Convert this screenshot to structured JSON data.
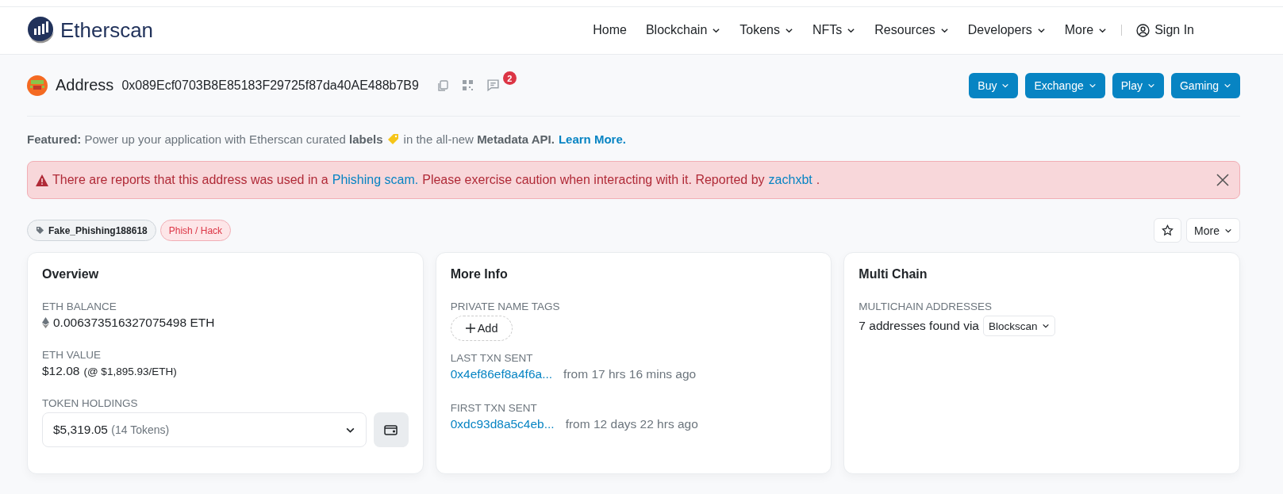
{
  "header": {
    "logo": "Etherscan",
    "nav": [
      {
        "label": "Home",
        "kind": "link"
      },
      {
        "label": "Blockchain",
        "kind": "dropdown"
      },
      {
        "label": "Tokens",
        "kind": "dropdown"
      },
      {
        "label": "NFTs",
        "kind": "dropdown"
      },
      {
        "label": "Resources",
        "kind": "dropdown"
      },
      {
        "label": "Developers",
        "kind": "dropdown"
      },
      {
        "label": "More",
        "kind": "dropdown"
      }
    ],
    "sign_in": "Sign In"
  },
  "address_bar": {
    "title": "Address",
    "address": "0x089Ecf0703B8E85183F29725f87da40AE488b7B9",
    "comment_count": "2",
    "actions": [
      "Buy",
      "Exchange",
      "Play",
      "Gaming"
    ]
  },
  "featured": {
    "text_before": "**Featured:** Power up your application with Etherscan curated **labels**",
    "text_after": "in the all-new **Metadata API.**",
    "link": "Learn More."
  },
  "alert": {
    "parts": [
      {
        "kind": "text",
        "text": "There are reports that this address was used in a"
      },
      {
        "kind": "link",
        "text": "Phishing scam."
      },
      {
        "kind": "text",
        "text": "Please exercise caution when interacting with it. Reported by"
      },
      {
        "kind": "link",
        "text": "zachxbt"
      },
      {
        "kind": "text",
        "text": "."
      }
    ]
  },
  "tags": [
    {
      "label": "Fake_Phishing188618",
      "kind": "name"
    },
    {
      "label": "Phish / Hack",
      "kind": "danger"
    }
  ],
  "more_button": "More",
  "overview": {
    "title": "Overview",
    "eth_balance_label": "ETH BALANCE",
    "eth_balance": "0.006373516327075498 ETH",
    "eth_value_label": "ETH VALUE",
    "eth_value": "$12.08",
    "eth_price": "(@ $1,895.93/ETH)",
    "token_label": "TOKEN HOLDINGS",
    "token_value": "$5,319.05",
    "token_count": "(14 Tokens)"
  },
  "more_info": {
    "title": "More Info",
    "private_tags_label": "PRIVATE NAME TAGS",
    "add_button": "Add",
    "txns": [
      {
        "label": "LAST TXN SENT",
        "hash": "0x4ef86ef8a4f6a...",
        "age": "from 17 hrs 16 mins ago"
      },
      {
        "label": "FIRST TXN SENT",
        "hash": "0xdc93d8a5c4eb...",
        "age": "from 12 days 22 hrs ago"
      }
    ]
  },
  "multi_chain": {
    "title": "Multi Chain",
    "label": "MULTICHAIN ADDRESSES",
    "text": "7 addresses found via",
    "source": "Blockscan"
  }
}
